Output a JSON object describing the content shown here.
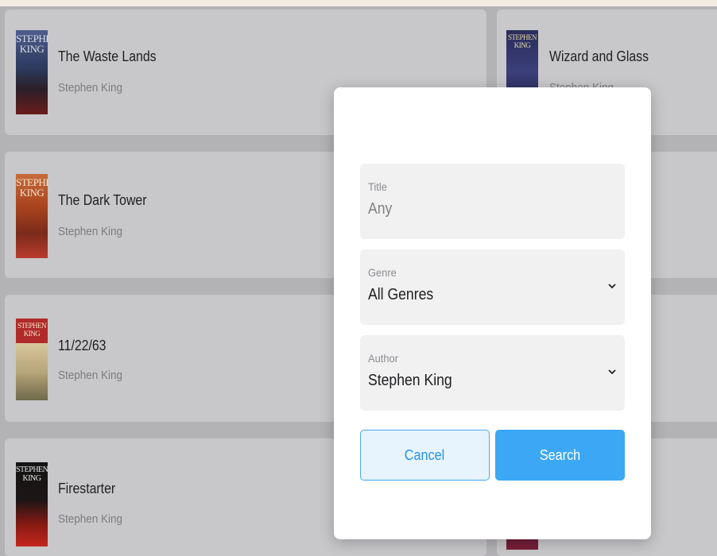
{
  "books_left": [
    {
      "title": "The Waste Lands",
      "author": "Stephen King",
      "cover_text": "STEPHEN\nKING"
    },
    {
      "title": "The Dark Tower",
      "author": "Stephen King",
      "cover_text": "STEPHEN\nKING"
    },
    {
      "title": "11/22/63",
      "author": "Stephen King",
      "cover_text": "STEPHEN KING"
    },
    {
      "title": "Firestarter",
      "author": "Stephen King",
      "cover_text": "STEPHEN KING"
    }
  ],
  "books_right": [
    {
      "title": "Wizard and Glass",
      "author": "Stephen King",
      "cover_text": "STEPHEN KING"
    }
  ],
  "search_modal": {
    "title_field": {
      "label": "Title",
      "placeholder": "Any"
    },
    "genre_field": {
      "label": "Genre",
      "value": "All Genres"
    },
    "author_field": {
      "label": "Author",
      "value": "Stephen King"
    },
    "cancel_label": "Cancel",
    "search_label": "Search"
  },
  "colors": {
    "accent": "#3ca8f5",
    "overlay_bg": "#b3b2b5",
    "card_bg": "#c8c7ca",
    "modal_bg": "#ffffff"
  }
}
